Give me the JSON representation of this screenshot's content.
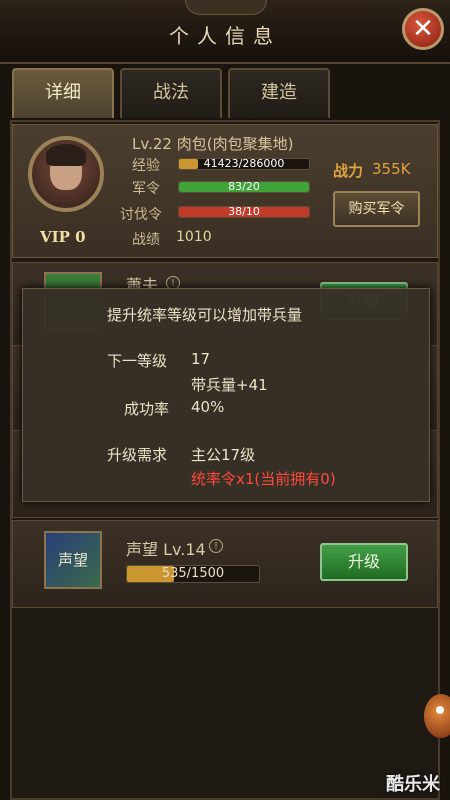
{
  "header": {
    "title": "个人信息",
    "close_label": "✕"
  },
  "tabs": [
    {
      "label": "详细",
      "active": true
    },
    {
      "label": "战法",
      "active": false
    },
    {
      "label": "建造",
      "active": false
    }
  ],
  "profile": {
    "level": "Lv.22",
    "name": "肉包(肉包聚集地)",
    "vip": "VIP 0",
    "stats": [
      {
        "label": "经验",
        "text": "41423/286000",
        "fraction": 0.145,
        "color": "#c9962f"
      },
      {
        "label": "军令",
        "text": "83/20",
        "fraction": 1.0,
        "color": "#3fa33a"
      },
      {
        "label": "讨伐令",
        "text": "38/10",
        "fraction": 1.0,
        "color": "#c23a2a"
      }
    ],
    "record_label": "战绩",
    "record_value": "1010",
    "power_label": "战力",
    "power_value": "355K",
    "buy_button": "购买军令"
  },
  "skills": [
    {
      "name": "蕭夫",
      "upgrade_label": "升级"
    },
    {
      "name": "声望 Lv.14",
      "icon_text": "声望",
      "progress_text": "535/1500",
      "progress_fraction": 0.3567,
      "upgrade_label": "升级"
    }
  ],
  "tooltip": {
    "headline": "提升统率等级可以增加带兵量",
    "next_level_label": "下一等级",
    "next_level_value": "17",
    "troop_bonus": "带兵量+41",
    "success_label": "成功率",
    "success_value": "40%",
    "requirement_label": "升级需求",
    "requirement_value": "主公17级",
    "requirement_missing": "统率令x1(当前拥有0)"
  },
  "watermark": "酷乐米",
  "colors": {
    "accent_gold": "#e0a43e",
    "button_green": "#2f8a33",
    "warning_red": "#ff4a3d"
  }
}
